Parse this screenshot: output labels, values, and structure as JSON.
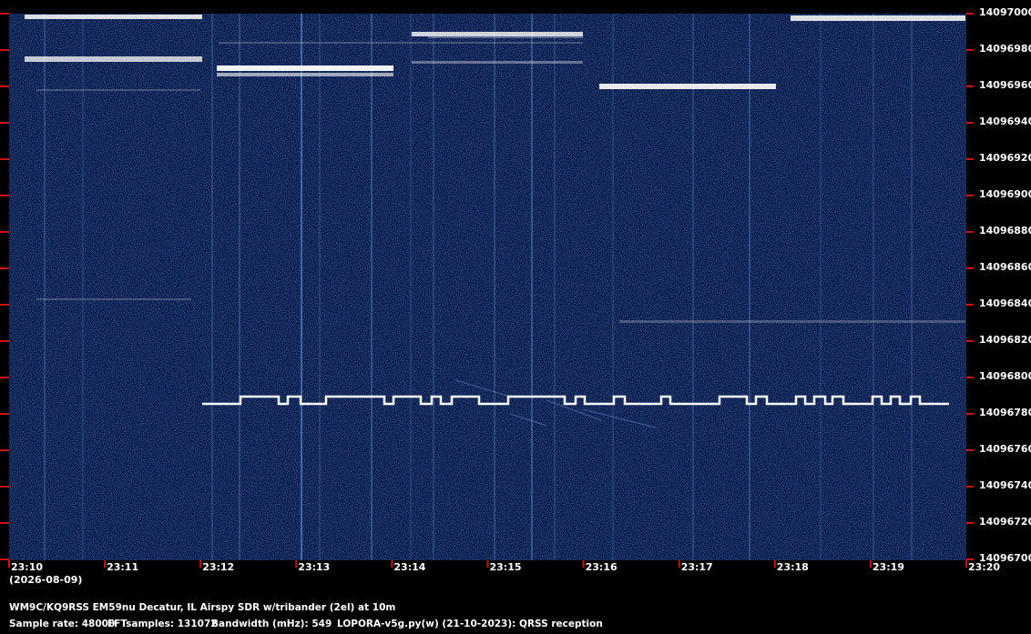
{
  "frequency_axis": {
    "ticks": [
      "14097000",
      "14096980",
      "14096960",
      "14096940",
      "14096920",
      "14096900",
      "14096880",
      "14096860",
      "14096840",
      "14096820",
      "14096800",
      "14096780",
      "14096760",
      "14096740",
      "14096720",
      "14096700"
    ],
    "tick_color": "#d01010"
  },
  "time_axis": {
    "ticks": [
      "23:10",
      "23:11",
      "23:12",
      "23:13",
      "23:14",
      "23:15",
      "23:16",
      "23:17",
      "23:18",
      "23:19",
      "23:20"
    ],
    "date": "(2026-08-09)"
  },
  "footer": {
    "station": "WM9C/KQ9RSS EM59nu Decatur, IL  Airspy SDR w/tribander (2el) at 10m",
    "sample_rate": "Sample rate: 48000",
    "fft_samples": "FFTsamples: 131072",
    "bandwidth": "Bandwidth (mHz): 549",
    "software": "LOPORA-v5g.py(w) (21-10-2023): QRSS reception"
  },
  "colors": {
    "background": "#0a1a45",
    "signal": "#ffffff",
    "axis_tick": "#d01010"
  }
}
